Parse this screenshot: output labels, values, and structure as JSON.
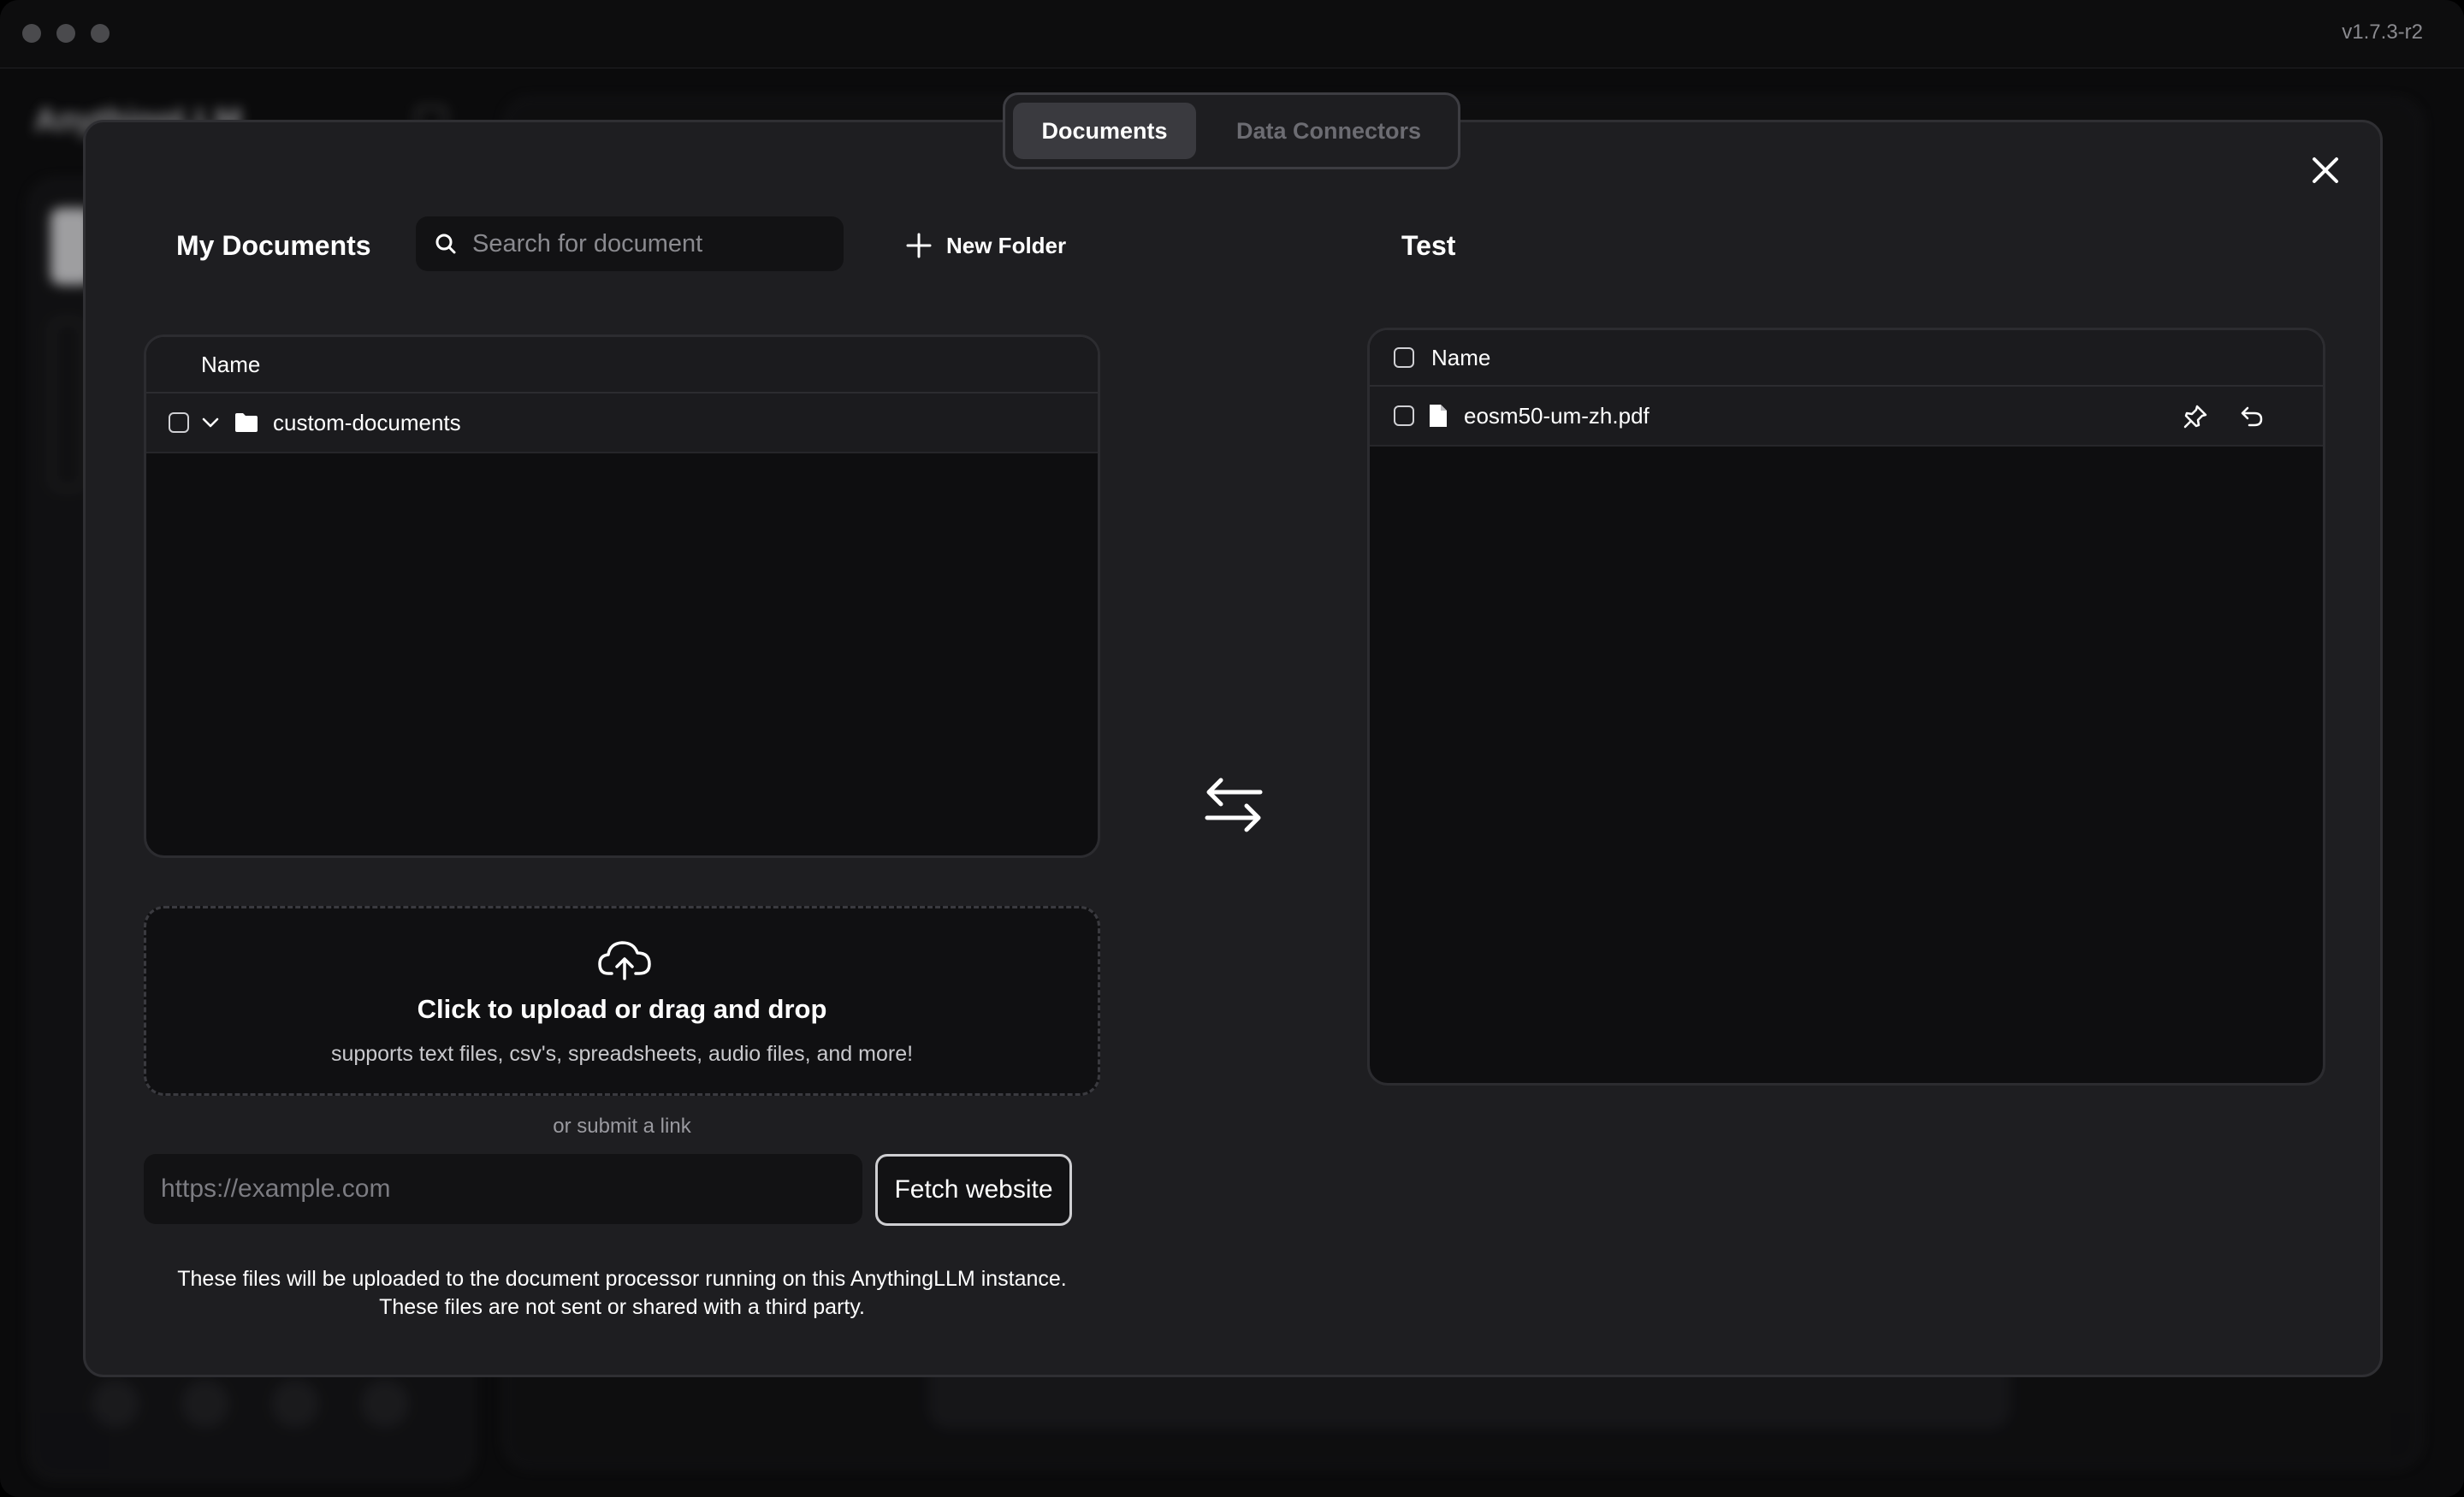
{
  "app": {
    "version": "v1.7.3-r2",
    "background_logo": "AnythingLLM"
  },
  "modal": {
    "tabs": [
      {
        "label": "Documents",
        "active": true
      },
      {
        "label": "Data Connectors",
        "active": false
      }
    ],
    "close_icon": "x-icon",
    "my_documents": {
      "title": "My Documents",
      "search_placeholder": "Search for document",
      "new_folder_label": "New Folder",
      "table_header": "Name",
      "items": [
        {
          "name": "custom-documents",
          "type": "folder",
          "expanded": true
        }
      ]
    },
    "workspace": {
      "title": "Test",
      "table_header": "Name",
      "items": [
        {
          "name": "eosm50-um-zh.pdf",
          "type": "file"
        }
      ]
    },
    "upload": {
      "title": "Click to upload or drag and drop",
      "subtitle": "supports text files, csv's, spreadsheets, audio files, and more!",
      "or_link": "or submit a link",
      "url_placeholder": "https://example.com",
      "fetch_label": "Fetch website",
      "notice_line1": "These files will be uploaded to the document processor running on this AnythingLLM instance.",
      "notice_line2": "These files are not sent or shared with a third party."
    }
  }
}
